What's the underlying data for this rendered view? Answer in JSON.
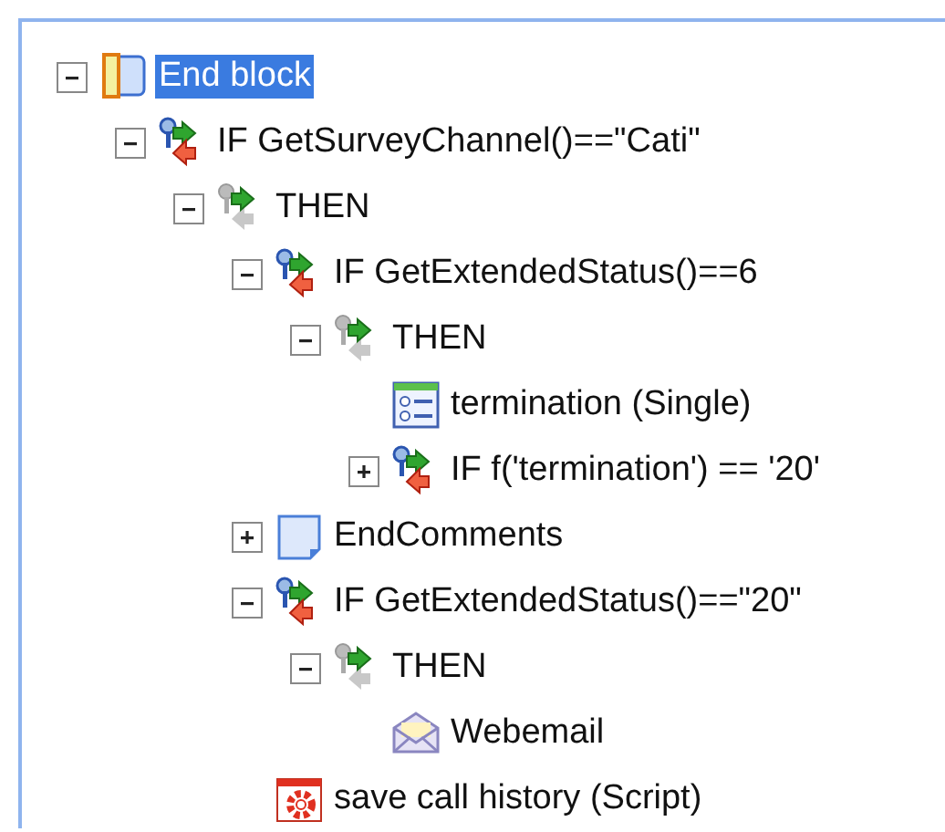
{
  "tree": [
    {
      "label": "End block",
      "kind": "block",
      "selected": true,
      "expanded": true,
      "children": [
        {
          "label": "IF GetSurveyChannel()==\"Cati\"",
          "kind": "if",
          "selected": false,
          "expanded": true,
          "children": [
            {
              "label": "THEN",
              "kind": "then",
              "selected": false,
              "expanded": true,
              "children": [
                {
                  "label": "IF GetExtendedStatus()==6",
                  "kind": "if",
                  "selected": false,
                  "expanded": true,
                  "children": [
                    {
                      "label": "THEN",
                      "kind": "then",
                      "selected": false,
                      "expanded": true,
                      "children": [
                        {
                          "label": "termination (Single)",
                          "kind": "question",
                          "selected": false
                        },
                        {
                          "label": "IF f('termination') == '20'",
                          "kind": "if",
                          "selected": false,
                          "expanded": false
                        }
                      ]
                    }
                  ]
                },
                {
                  "label": "EndComments",
                  "kind": "comment",
                  "selected": false,
                  "expanded": false
                },
                {
                  "label": "IF GetExtendedStatus()==\"20\"",
                  "kind": "if",
                  "selected": false,
                  "expanded": true,
                  "children": [
                    {
                      "label": "THEN",
                      "kind": "then",
                      "selected": false,
                      "expanded": true,
                      "children": [
                        {
                          "label": "Webemail",
                          "kind": "email",
                          "selected": false
                        }
                      ]
                    }
                  ]
                },
                {
                  "label": "save call history (Script)",
                  "kind": "script",
                  "selected": false
                }
              ]
            }
          ]
        }
      ]
    }
  ]
}
